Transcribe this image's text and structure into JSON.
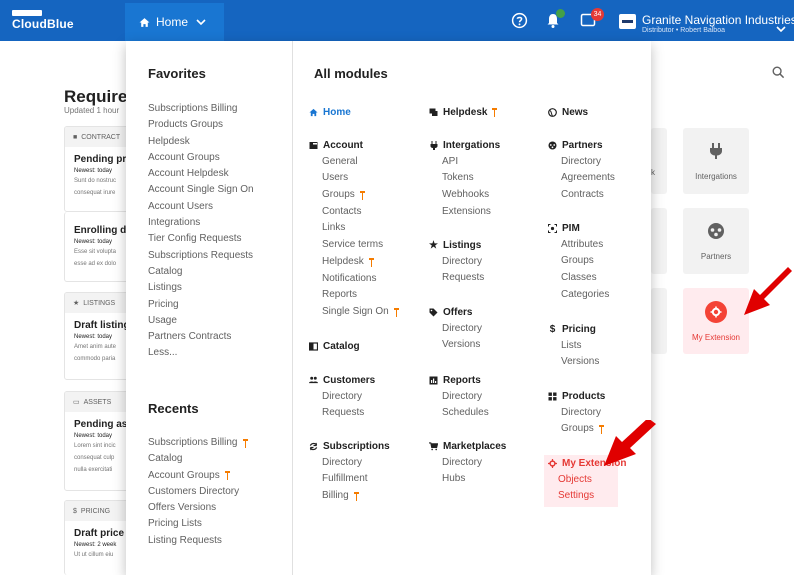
{
  "topbar": {
    "logo_text": "CloudBlue",
    "home_label": "Home",
    "notifications_badge": "34",
    "account_name": "Granite Navigation Industries",
    "account_subtitle": "Distributor • Robert Balboa"
  },
  "background": {
    "title": "Require",
    "updated": "Updated 1 hour",
    "cards": [
      {
        "header": "CONTRACT",
        "title": "Pending pro",
        "newest": "Newest: today",
        "text1": "Sunt do nostruc",
        "text2": "consequat irure"
      },
      {
        "header": "",
        "title": "Enrolling dis",
        "newest": "Newest: today",
        "text1": "Esse sit volupta",
        "text2": "esse ad ex dolo"
      },
      {
        "header": "LISTINGS",
        "title": "Draft listing",
        "newest": "Newest: today",
        "text1": "Amet anim aute",
        "text2": "commodo paria"
      },
      {
        "header": "ASSETS",
        "title": "Pending ass",
        "newest": "Newest: today",
        "text1": "Lorem sint incic",
        "text2": "consequat culp",
        "text3": "nulla exercitati"
      },
      {
        "header": "PRICING",
        "title": "Draft price l",
        "newest": "Newest: 2 week",
        "text1": "Ut ut cillum eiu"
      }
    ],
    "tiles": [
      {
        "label": "k",
        "partial": true
      },
      {
        "label": "Intergations"
      },
      {
        "label": "Partners"
      },
      {
        "label": "My Extension"
      }
    ]
  },
  "menu": {
    "favorites_title": "Favorites",
    "favorites": [
      {
        "label": "Subscriptions Billing"
      },
      {
        "label": "Products Groups"
      },
      {
        "label": "Helpdesk"
      },
      {
        "label": "Account Groups"
      },
      {
        "label": "Account Helpdesk"
      },
      {
        "label": "Account Single Sign On"
      },
      {
        "label": "Account Users"
      },
      {
        "label": "Integrations"
      },
      {
        "label": "Tier Config Requests"
      },
      {
        "label": "Subscriptions Requests"
      },
      {
        "label": "Catalog"
      },
      {
        "label": "Listings"
      },
      {
        "label": "Pricing"
      },
      {
        "label": "Usage"
      },
      {
        "label": "Partners Contracts"
      },
      {
        "label": "Less..."
      }
    ],
    "recents_title": "Recents",
    "recents": [
      {
        "label": "Subscriptions Billing",
        "pinned": true
      },
      {
        "label": "Catalog"
      },
      {
        "label": "Account Groups",
        "pinned": true
      },
      {
        "label": "Customers Directory"
      },
      {
        "label": "Offers Versions"
      },
      {
        "label": "Pricing Lists"
      },
      {
        "label": "Listing Requests"
      }
    ],
    "all_modules_title": "All modules",
    "modules": {
      "col1": [
        {
          "name": "Home",
          "icon": "home-icon",
          "items": []
        },
        {
          "name": "Account",
          "icon": "account-icon",
          "items": [
            {
              "label": "General"
            },
            {
              "label": "Users"
            },
            {
              "label": "Groups",
              "pinned": true
            },
            {
              "label": "Contacts"
            },
            {
              "label": "Links"
            },
            {
              "label": "Service terms"
            },
            {
              "label": "Helpdesk",
              "pinned": true
            },
            {
              "label": "Notifications"
            },
            {
              "label": "Reports"
            },
            {
              "label": "Single Sign On",
              "pinned": true
            }
          ]
        },
        {
          "name": "Catalog",
          "icon": "catalog-icon",
          "items": []
        },
        {
          "name": "Customers",
          "icon": "customers-icon",
          "items": [
            {
              "label": "Directory"
            },
            {
              "label": "Requests"
            }
          ]
        },
        {
          "name": "Subscriptions",
          "icon": "subscriptions-icon",
          "items": [
            {
              "label": "Directory"
            },
            {
              "label": "Fulfillment"
            },
            {
              "label": "Billing",
              "pinned": true
            }
          ]
        }
      ],
      "col2": [
        {
          "name": "Helpdesk",
          "icon": "helpdesk-icon",
          "pinned": true,
          "items": []
        },
        {
          "name": "Intergations",
          "icon": "integrations-icon",
          "items": [
            {
              "label": "API"
            },
            {
              "label": "Tokens"
            },
            {
              "label": "Webhooks"
            },
            {
              "label": "Extensions"
            }
          ]
        },
        {
          "name": "Listings",
          "icon": "listings-icon",
          "items": [
            {
              "label": "Directory"
            },
            {
              "label": "Requests"
            }
          ]
        },
        {
          "name": "Offers",
          "icon": "offers-icon",
          "items": [
            {
              "label": "Directory"
            },
            {
              "label": "Versions"
            }
          ]
        },
        {
          "name": "Reports",
          "icon": "reports-icon",
          "items": [
            {
              "label": "Directory"
            },
            {
              "label": "Schedules"
            }
          ]
        },
        {
          "name": "Marketplaces",
          "icon": "marketplaces-icon",
          "items": [
            {
              "label": "Directory"
            },
            {
              "label": "Hubs"
            }
          ]
        }
      ],
      "col3": [
        {
          "name": "News",
          "icon": "news-icon",
          "items": []
        },
        {
          "name": "Partners",
          "icon": "partners-icon",
          "items": [
            {
              "label": "Directory"
            },
            {
              "label": "Agreements"
            },
            {
              "label": "Contracts"
            }
          ]
        },
        {
          "name": "PIM",
          "icon": "pim-icon",
          "items": [
            {
              "label": "Attributes"
            },
            {
              "label": "Groups"
            },
            {
              "label": "Classes"
            },
            {
              "label": "Categories"
            }
          ]
        },
        {
          "name": "Pricing",
          "icon": "pricing-icon",
          "items": [
            {
              "label": "Lists"
            },
            {
              "label": "Versions"
            }
          ]
        },
        {
          "name": "Products",
          "icon": "products-icon",
          "items": [
            {
              "label": "Directory"
            },
            {
              "label": "Groups",
              "pinned": true
            }
          ]
        },
        {
          "name": "My Extension",
          "icon": "extension-icon",
          "items": [
            {
              "label": "Objects"
            },
            {
              "label": "Settings"
            }
          ]
        }
      ]
    }
  },
  "colors": {
    "brand": "#1565c0",
    "active_nav": "#1976d2",
    "pin": "#f57c00",
    "extension": "#e53935",
    "annotation_arrow": "#e00000"
  }
}
